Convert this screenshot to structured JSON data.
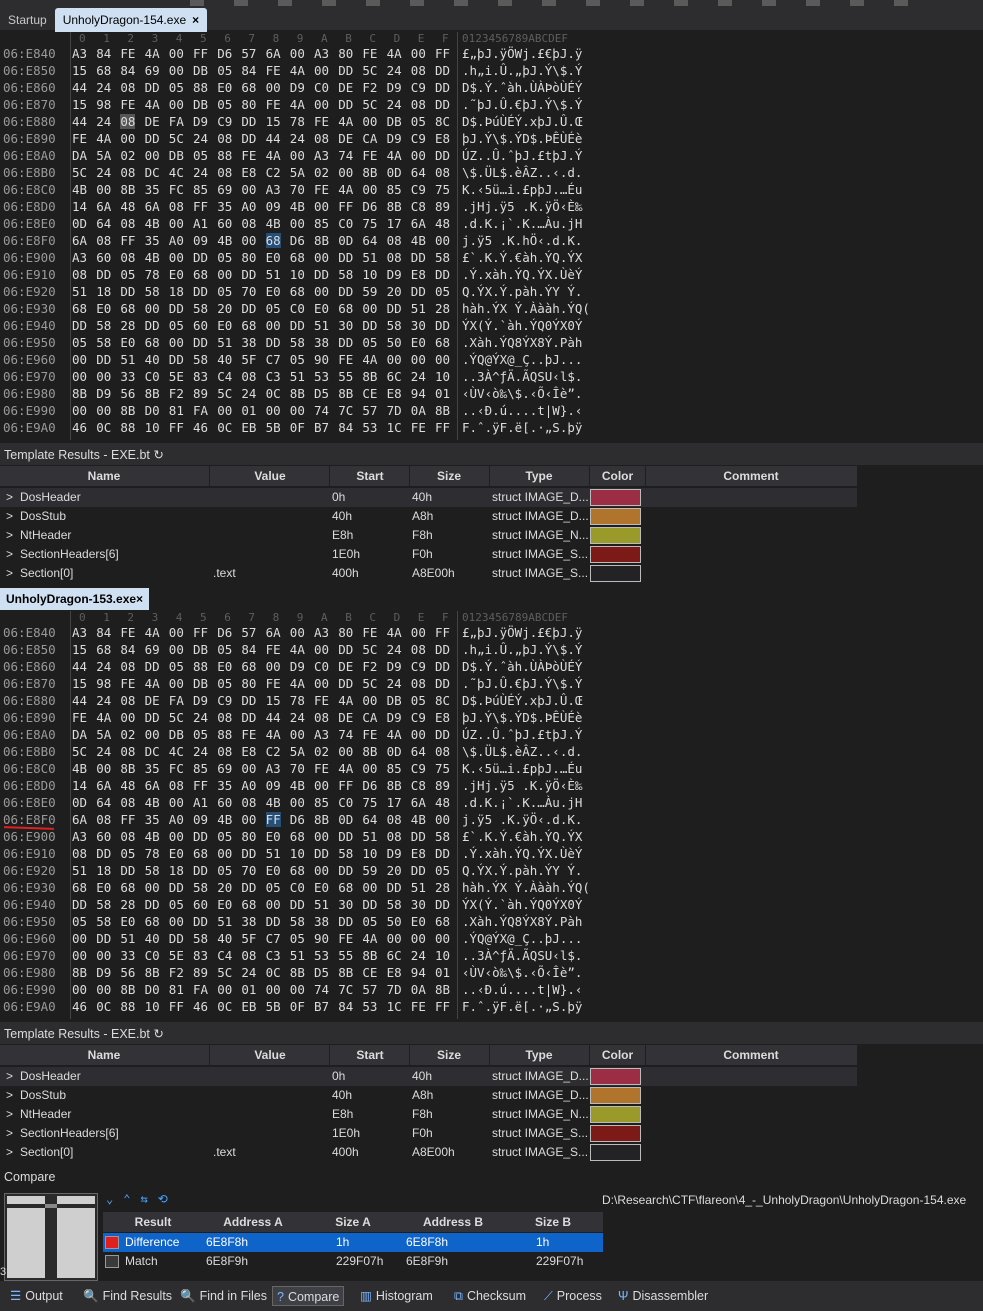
{
  "tabs_top": {
    "startup": "Startup",
    "file1": "UnholyDragon-154.exe",
    "close": "×"
  },
  "file2_tab": "UnholyDragon-153.exe",
  "ruler": {
    "hex": [
      "0",
      "1",
      "2",
      "3",
      "4",
      "5",
      "6",
      "7",
      "8",
      "9",
      "A",
      "B",
      "C",
      "D",
      "E",
      "F"
    ],
    "ascii": "0123456789ABCDEF"
  },
  "hex1": [
    {
      "addr": "06:E840",
      "bytes": [
        "A3",
        "84",
        "FE",
        "4A",
        "00",
        "FF",
        "D6",
        "57",
        "6A",
        "00",
        "A3",
        "80",
        "FE",
        "4A",
        "00",
        "FF"
      ],
      "ascii": "£„þJ.ÿÖWj.£€þJ.ÿ"
    },
    {
      "addr": "06:E850",
      "bytes": [
        "15",
        "68",
        "84",
        "69",
        "00",
        "DB",
        "05",
        "84",
        "FE",
        "4A",
        "00",
        "DD",
        "5C",
        "24",
        "08",
        "DD"
      ],
      "ascii": ".h„i.Û.„þJ.Ý\\$.Ý"
    },
    {
      "addr": "06:E860",
      "bytes": [
        "44",
        "24",
        "08",
        "DD",
        "05",
        "88",
        "E0",
        "68",
        "00",
        "D9",
        "C0",
        "DE",
        "F2",
        "D9",
        "C9",
        "DD"
      ],
      "ascii": "D$.Ý.ˆàh.ÙÀÞòÙÉÝ"
    },
    {
      "addr": "06:E870",
      "bytes": [
        "15",
        "98",
        "FE",
        "4A",
        "00",
        "DB",
        "05",
        "80",
        "FE",
        "4A",
        "00",
        "DD",
        "5C",
        "24",
        "08",
        "DD"
      ],
      "ascii": ".˜þJ.Û.€þJ.Ý\\$.Ý"
    },
    {
      "addr": "06:E880",
      "bytes": [
        "44",
        "24",
        "08",
        "DE",
        "FA",
        "D9",
        "C9",
        "DD",
        "15",
        "78",
        "FE",
        "4A",
        "00",
        "DB",
        "05",
        "8C"
      ],
      "ascii": "D$.ÞúÙÉÝ.xþJ.Û.Œ"
    },
    {
      "addr": "06:E890",
      "bytes": [
        "FE",
        "4A",
        "00",
        "DD",
        "5C",
        "24",
        "08",
        "DD",
        "44",
        "24",
        "08",
        "DE",
        "CA",
        "D9",
        "C9",
        "E8"
      ],
      "ascii": "þJ.Ý\\$.ÝD$.ÞÊÙÉè"
    },
    {
      "addr": "06:E8A0",
      "bytes": [
        "DA",
        "5A",
        "02",
        "00",
        "DB",
        "05",
        "88",
        "FE",
        "4A",
        "00",
        "A3",
        "74",
        "FE",
        "4A",
        "00",
        "DD"
      ],
      "ascii": "ÚZ..Û.ˆþJ.£tþJ.Ý"
    },
    {
      "addr": "06:E8B0",
      "bytes": [
        "5C",
        "24",
        "08",
        "DC",
        "4C",
        "24",
        "08",
        "E8",
        "C2",
        "5A",
        "02",
        "00",
        "8B",
        "0D",
        "64",
        "08"
      ],
      "ascii": "\\$.ÜL$.èÂZ..‹.d."
    },
    {
      "addr": "06:E8C0",
      "bytes": [
        "4B",
        "00",
        "8B",
        "35",
        "FC",
        "85",
        "69",
        "00",
        "A3",
        "70",
        "FE",
        "4A",
        "00",
        "85",
        "C9",
        "75"
      ],
      "ascii": "K.‹5ü…i.£pþJ.…Éu"
    },
    {
      "addr": "06:E8D0",
      "bytes": [
        "14",
        "6A",
        "48",
        "6A",
        "08",
        "FF",
        "35",
        "A0",
        "09",
        "4B",
        "00",
        "FF",
        "D6",
        "8B",
        "C8",
        "89"
      ],
      "ascii": ".jHj.ÿ5 .K.ÿÖ‹È‰"
    },
    {
      "addr": "06:E8E0",
      "bytes": [
        "0D",
        "64",
        "08",
        "4B",
        "00",
        "A1",
        "60",
        "08",
        "4B",
        "00",
        "85",
        "C0",
        "75",
        "17",
        "6A",
        "48"
      ],
      "ascii": ".d.K.¡`.K.…Àu.jH"
    },
    {
      "addr": "06:E8F0",
      "bytes": [
        "6A",
        "08",
        "FF",
        "35",
        "A0",
        "09",
        "4B",
        "00",
        "68",
        "D6",
        "8B",
        "0D",
        "64",
        "08",
        "4B",
        "00"
      ],
      "ascii": "j.ÿ5 .K.hÖ‹.d.K."
    },
    {
      "addr": "06:E900",
      "bytes": [
        "A3",
        "60",
        "08",
        "4B",
        "00",
        "DD",
        "05",
        "80",
        "E0",
        "68",
        "00",
        "DD",
        "51",
        "08",
        "DD",
        "58"
      ],
      "ascii": "£`.K.Ý.€àh.ÝQ.ÝX"
    },
    {
      "addr": "06:E910",
      "bytes": [
        "08",
        "DD",
        "05",
        "78",
        "E0",
        "68",
        "00",
        "DD",
        "51",
        "10",
        "DD",
        "58",
        "10",
        "D9",
        "E8",
        "DD"
      ],
      "ascii": ".Ý.xàh.ÝQ.ÝX.ÙèÝ"
    },
    {
      "addr": "06:E920",
      "bytes": [
        "51",
        "18",
        "DD",
        "58",
        "18",
        "DD",
        "05",
        "70",
        "E0",
        "68",
        "00",
        "DD",
        "59",
        "20",
        "DD",
        "05"
      ],
      "ascii": "Q.ÝX.Ý.pàh.ÝY Ý."
    },
    {
      "addr": "06:E930",
      "bytes": [
        "68",
        "E0",
        "68",
        "00",
        "DD",
        "58",
        "20",
        "DD",
        "05",
        "C0",
        "E0",
        "68",
        "00",
        "DD",
        "51",
        "28"
      ],
      "ascii": "hàh.ÝX Ý.Àààh.ÝQ("
    },
    {
      "addr": "06:E940",
      "bytes": [
        "DD",
        "58",
        "28",
        "DD",
        "05",
        "60",
        "E0",
        "68",
        "00",
        "DD",
        "51",
        "30",
        "DD",
        "58",
        "30",
        "DD"
      ],
      "ascii": "ÝX(Ý.`àh.ÝQ0ÝX0Ý"
    },
    {
      "addr": "06:E950",
      "bytes": [
        "05",
        "58",
        "E0",
        "68",
        "00",
        "DD",
        "51",
        "38",
        "DD",
        "58",
        "38",
        "DD",
        "05",
        "50",
        "E0",
        "68"
      ],
      "ascii": ".Xàh.ÝQ8ÝX8Ý.Pàh"
    },
    {
      "addr": "06:E960",
      "bytes": [
        "00",
        "DD",
        "51",
        "40",
        "DD",
        "58",
        "40",
        "5F",
        "C7",
        "05",
        "90",
        "FE",
        "4A",
        "00",
        "00",
        "00"
      ],
      "ascii": ".ÝQ@ÝX@_Ç..þJ..."
    },
    {
      "addr": "06:E970",
      "bytes": [
        "00",
        "00",
        "33",
        "C0",
        "5E",
        "83",
        "C4",
        "08",
        "C3",
        "51",
        "53",
        "55",
        "8B",
        "6C",
        "24",
        "10"
      ],
      "ascii": "..3À^ƒÄ.ÃQSU‹l$."
    },
    {
      "addr": "06:E980",
      "bytes": [
        "8B",
        "D9",
        "56",
        "8B",
        "F2",
        "89",
        "5C",
        "24",
        "0C",
        "8B",
        "D5",
        "8B",
        "CE",
        "E8",
        "94",
        "01"
      ],
      "ascii": "‹ÙV‹ò‰\\$.‹Õ‹Îè”."
    },
    {
      "addr": "06:E990",
      "bytes": [
        "00",
        "00",
        "8B",
        "D0",
        "81",
        "FA",
        "00",
        "01",
        "00",
        "00",
        "74",
        "7C",
        "57",
        "7D",
        "0A",
        "8B"
      ],
      "ascii": "..‹Ð.ú....t|W}.‹"
    },
    {
      "addr": "06:E9A0",
      "bytes": [
        "46",
        "0C",
        "88",
        "10",
        "FF",
        "46",
        "0C",
        "EB",
        "5B",
        "0F",
        "B7",
        "84",
        "53",
        "1C",
        "FE",
        "FF"
      ],
      "ascii": "F.ˆ.ÿF.ë[.·„S.þÿ"
    }
  ],
  "hex2_diff": {
    "row": 11,
    "col": 8,
    "byte": "FF",
    "ascii_char": "ÿ"
  },
  "template_header": "Template Results - EXE.bt",
  "refresh_icon": "↻",
  "table_cols": {
    "name": "Name",
    "value": "Value",
    "start": "Start",
    "size": "Size",
    "type": "Type",
    "color": "Color",
    "comment": "Comment"
  },
  "template_rows": [
    {
      "chev": ">",
      "name": "DosHeader",
      "value": "",
      "start": "0h",
      "size": "40h",
      "type": "struct IMAGE_D...",
      "color": "#9b2d45"
    },
    {
      "chev": ">",
      "name": "DosStub",
      "value": "",
      "start": "40h",
      "size": "A8h",
      "type": "struct IMAGE_D...",
      "color": "#b0742c"
    },
    {
      "chev": ">",
      "name": "NtHeader",
      "value": "",
      "start": "E8h",
      "size": "F8h",
      "type": "struct IMAGE_N...",
      "color": "#9a9a2a"
    },
    {
      "chev": ">",
      "name": "SectionHeaders[6]",
      "value": "",
      "start": "1E0h",
      "size": "F0h",
      "type": "struct IMAGE_S...",
      "color": "#7c1a18"
    },
    {
      "chev": ">",
      "name": "Section[0]",
      "value": ".text",
      "start": "400h",
      "size": "A8E00h",
      "type": "struct IMAGE_S...",
      "color": "#232326"
    }
  ],
  "compare": {
    "title": "Compare",
    "path": "D:\\Research\\CTF\\flareon\\4_-_UnholyDragon\\UnholyDragon-154.exe",
    "cols": {
      "result": "Result",
      "addrA": "Address A",
      "sizeA": "Size A",
      "addrB": "Address B",
      "sizeB": "Size B"
    },
    "rows": [
      {
        "result": "Difference",
        "addrA": "6E8F8h",
        "sizeA": "1h",
        "addrB": "6E8F8h",
        "sizeB": "1h",
        "box": "#e02020"
      },
      {
        "result": "Match",
        "addrA": "6E8F9h",
        "sizeA": "229F07h",
        "addrB": "6E8F9h",
        "sizeB": "229F07h",
        "box": "#3a3a3a"
      }
    ],
    "tools": [
      "⌄",
      "⌃",
      "⇆",
      "⟲"
    ],
    "margin_num": "3"
  },
  "bottom_tabs": [
    "Output",
    "Find Results",
    "Find in Files",
    "Compare",
    "Histogram",
    "Checksum",
    "Process",
    "Disassembler"
  ],
  "bottom_icons": [
    "☰",
    "🔍",
    "🔍",
    "?",
    "▥",
    "⧉",
    "⟋",
    "Ψ"
  ]
}
